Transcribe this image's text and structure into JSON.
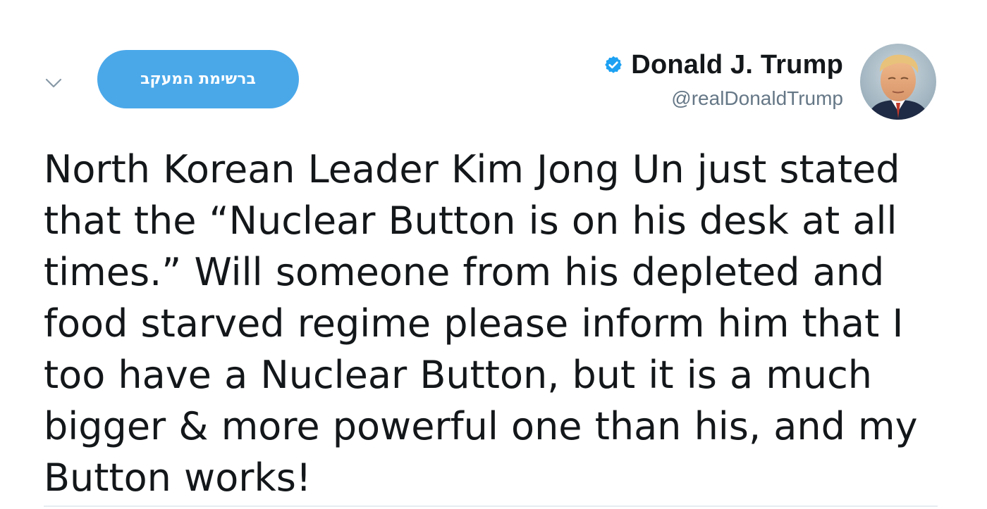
{
  "header": {
    "follow_label": "ברשימת המעקב",
    "display_name": "Donald J. Trump",
    "handle": "@realDonaldTrump",
    "verified": true,
    "accent_color": "#4aa8e9"
  },
  "icons": {
    "menu": "chevron-down-icon",
    "verified": "verified-badge-icon",
    "avatar": "avatar"
  },
  "tweet": {
    "text": "North Korean Leader Kim Jong Un just stated that the “Nuclear Button is on his desk at all times.” Will someone from his depleted and food starved regime please inform him that I too have a Nuclear Button, but it is a much bigger & more powerful one than his, and my Button works!"
  }
}
